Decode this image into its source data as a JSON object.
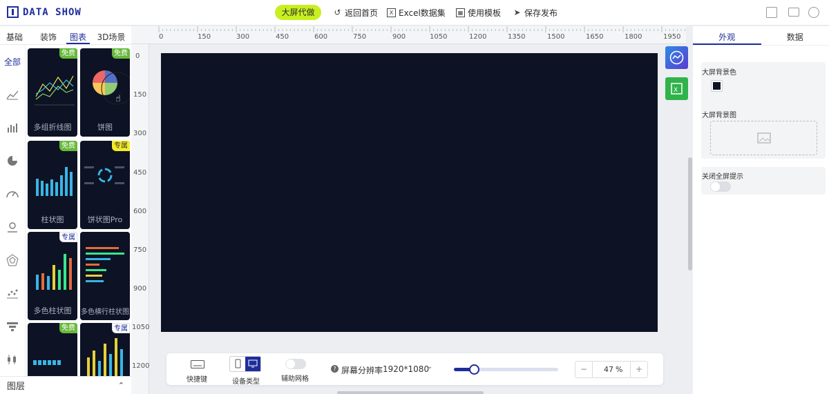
{
  "app": {
    "logo_text": "DATA SHOW"
  },
  "toolbar": {
    "promo": "大屏代做",
    "home": "返回首页",
    "excel": "Excel数据集",
    "template": "使用模板",
    "publish": "保存发布"
  },
  "left": {
    "tabs": [
      "基础",
      "装饰",
      "图表",
      "3D场景"
    ],
    "active_tab": "图表",
    "all": "全部",
    "layers": "图层",
    "cards": [
      {
        "name": "多组折线图",
        "badge": "免费"
      },
      {
        "name": "饼图",
        "badge": "免费"
      },
      {
        "name": "柱状图",
        "badge": "免费"
      },
      {
        "name": "饼状图Pro",
        "badge": "专属"
      },
      {
        "name": "多色柱状图",
        "badge": "专属"
      },
      {
        "name": "多色横行柱状图",
        "badge": ""
      },
      {
        "name": "",
        "badge": "免费"
      },
      {
        "name": "",
        "badge": "专属"
      }
    ]
  },
  "rulers": {
    "top": [
      "0",
      "150",
      "300",
      "450",
      "600",
      "750",
      "900",
      "1050",
      "1200",
      "1350",
      "1500",
      "1650",
      "1800",
      "1950"
    ],
    "left": [
      "0",
      "150",
      "300",
      "450",
      "600",
      "750",
      "900",
      "1050",
      "1200"
    ]
  },
  "bottom": {
    "shortcut": "快捷键",
    "device": "设备类型",
    "grid": "辅助网格",
    "resolution_label": "屏幕分辨率",
    "resolution": "1920*1080",
    "zoom": "47",
    "zoom_unit": "%",
    "minus": "−",
    "plus": "+",
    "slider_fraction": 0.19
  },
  "right": {
    "tabs": [
      "外观",
      "数据"
    ],
    "active_tab": "外观",
    "bg_color_label": "大屏背景色",
    "bg_color": "#0d1224",
    "bg_image_label": "大屏背景图",
    "fullscreen_label": "关闭全屏提示"
  },
  "colors": {
    "accent": "#1f2d9b",
    "promo": "#c8ef1f",
    "canvas": "#0d1224",
    "free": "#67b93a",
    "vip": "#f5ec24"
  }
}
